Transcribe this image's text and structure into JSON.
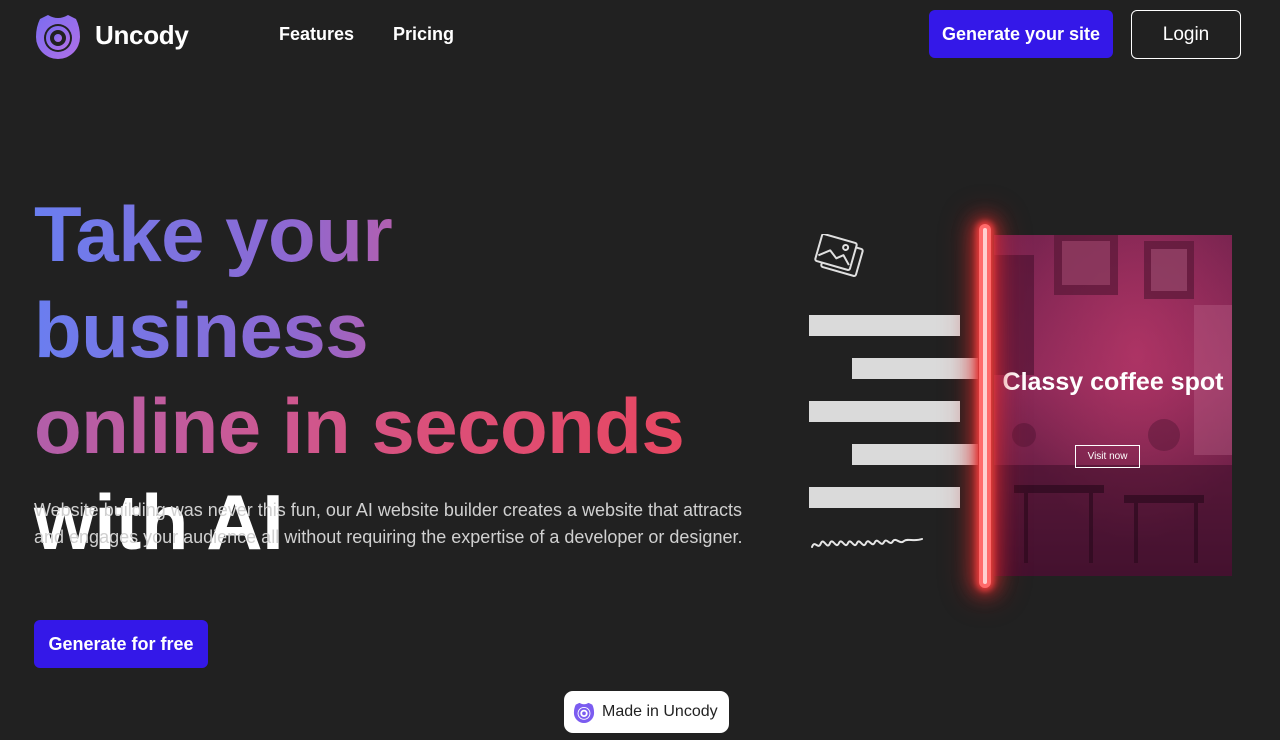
{
  "brand": {
    "name": "Uncody"
  },
  "nav": {
    "links": [
      "Features",
      "Pricing"
    ],
    "cta_label": "Generate your site",
    "login_label": "Login"
  },
  "hero": {
    "headline_line1": "Take your business",
    "headline_line2": "online in seconds",
    "headline_line3": "with AI",
    "subtext": "Website building was never this fun, our AI website builder creates a website that attracts and engages your audience all without requiring the expertise of a developer or designer.",
    "cta_label": "Generate for free"
  },
  "illustration": {
    "card_title": "Classy coffee spot",
    "card_button": "Visit now",
    "image_icon": "image-icon"
  },
  "badge": {
    "label": "Made in Uncody",
    "icon": "uncody-logo-icon"
  },
  "colors": {
    "background": "#212121",
    "primary": "#3418e8",
    "gradient_start": "#6a7ef0",
    "gradient_end": "#e8465f",
    "neon": "#e23b3b"
  }
}
